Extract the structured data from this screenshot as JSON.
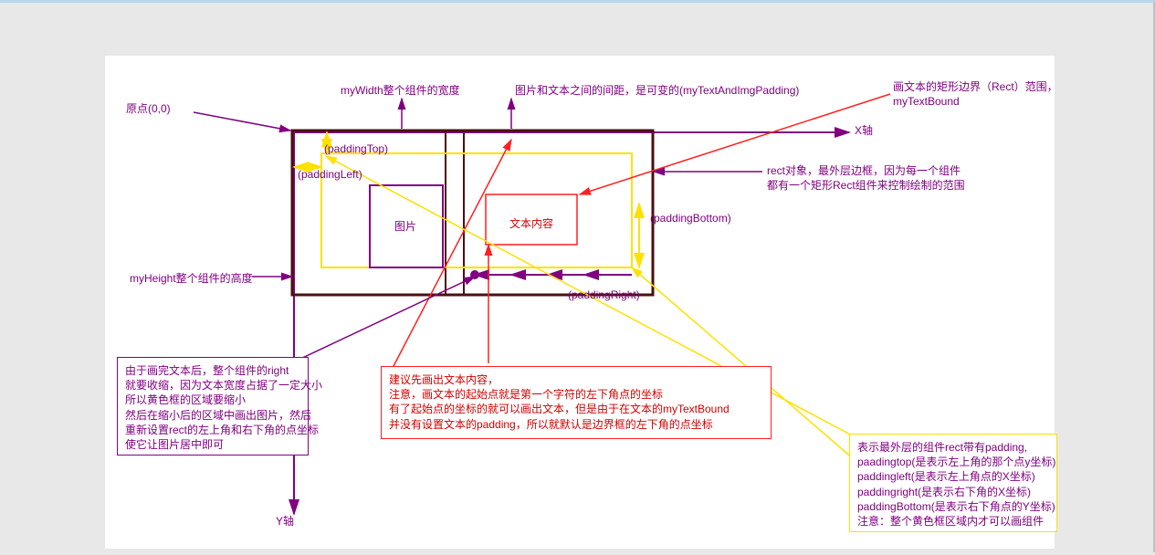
{
  "labels": {
    "origin": "原点(0,0)",
    "myWidth": "myWidth整个组件的宽度",
    "gap": "图片和文本之间的间距，是可变的(myTextAndImgPadding)",
    "paddingTop": "(paddingTop)",
    "paddingLeft": "(paddingLeft)",
    "paddingRight": "(paddingRight)",
    "paddingBottom": "(paddingBottom)",
    "myHeight": "myHeight整个组件的高度",
    "imgLabel": "图片",
    "textLabel": "文本内容",
    "xAxis": "X轴",
    "yAxis": "Y轴",
    "textBound": "画文本的矩形边界（Rect）范围，\nmyTextBound",
    "rectObj": "rect对象，最外层边框，因为每一个组件\n都有一个矩形Rect组件来控制绘制的范围"
  },
  "purpleBox": "由于画完文本后，整个组件的right\n就要收缩，因为文本宽度占据了一定大小\n所以黄色框的区域要缩小\n然后在缩小后的区域中画出图片，然后\n重新设置rect的左上角和右下角的点坐标\n使它让图片居中即可",
  "redBox": "建议先画出文本内容，\n注意，画文本的起始点就是第一个字符的左下角点的坐标\n有了起始点的坐标的就可以画出文本，但是由于在文本的myTextBound\n并没有设置文本的padding，所以就默认是边界框的左下角的点坐标",
  "yellowBox": "表示最外层的组件rect带有padding,\npaadingtop(是表示左上角的那个点y坐标)\npaddingleft(是表示左上角点的X坐标)\npaddingright(是表示右下角的X坐标)\npaddingBottom(是表示右下角点的Y坐标)\n注意：整个黄色框区域内才可以画组件"
}
